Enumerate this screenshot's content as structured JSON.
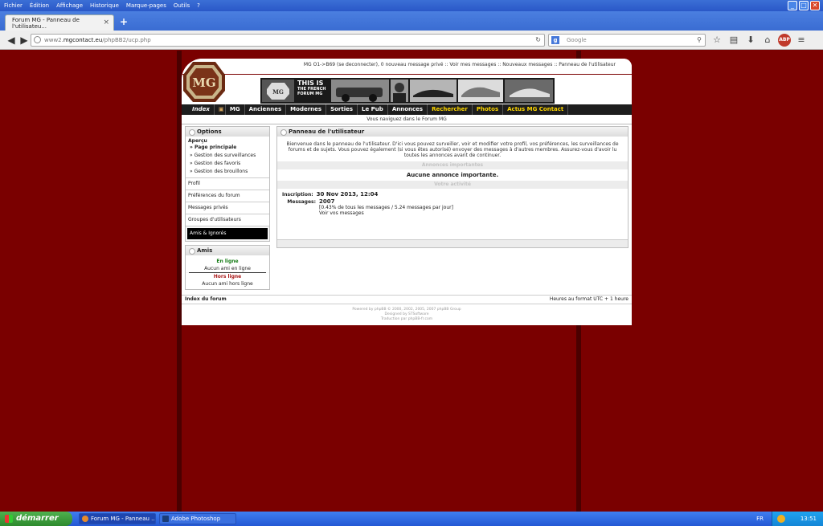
{
  "window": {
    "menu": [
      "Fichier",
      "Édition",
      "Affichage",
      "Historique",
      "Marque-pages",
      "Outils",
      "?"
    ],
    "buttons": {
      "minimize": "_",
      "maximize": "□",
      "close": "✕"
    }
  },
  "tab": {
    "title": "Forum MG - Panneau de l'utilisateu...",
    "close": "×",
    "new_tab": "+"
  },
  "navigation": {
    "url_prefix": "www2.",
    "url_host": "mgcontact.eu",
    "url_path": "/phpBB2/ucp.php",
    "search_engine": "g",
    "search_placeholder": "Google",
    "reload": "↻",
    "search_go": "⚲"
  },
  "forum": {
    "user_bar": "MG O1->B69 (se deconnecter), 0 nouveau message privé :: Voir mes messages :: Nouveaux messages :: Panneau de l'utilisateur",
    "banner_title": "THIS IS",
    "banner_sub": "THE FRENCH",
    "banner_sub2": "FORUM MG",
    "nav": [
      "Index",
      "MG",
      "Anciennes",
      "Modernes",
      "Sorties",
      "Le Pub",
      "Annonces",
      "Rechercher",
      "Photos",
      "Actus MG Contact"
    ],
    "browsing": "Vous naviguez dans le Forum MG",
    "sidebar": {
      "options_title": "Options",
      "overview_title": "Aperçu",
      "overview_items": [
        "» Page principale",
        "» Gestion des surveillances",
        "» Gestion des favoris",
        "» Gestion des brouillons"
      ],
      "items": [
        "Profil",
        "Préférences du forum",
        "Messages privés",
        "Groupes d'utilisateurs",
        "Amis & Ignorés"
      ],
      "friends_title": "Amis",
      "online_label": "En ligne",
      "online_none": "Aucun ami en ligne",
      "offline_label": "Hors ligne",
      "offline_none": "Aucun ami hors ligne"
    },
    "main": {
      "title": "Panneau de l'utilisateur",
      "intro": "Bienvenue dans le panneau de l'utilisateur. D'ici vous pouvez surveiller, voir et modifier votre profil, vos préférences, les surveillances de forums et de sujets. Vous pouvez également (si vous êtes autorisé) envoyer des messages à d'autres membres. Assurez-vous d'avoir lu toutes les annonces avant de continuer.",
      "important_title": "Annonces importantes",
      "no_announcement": "Aucune annonce importante.",
      "activity_title": "Votre activité",
      "joined_label": "Inscription:",
      "joined_value": "30 Nov 2013, 12:04",
      "messages_label": "Messages:",
      "messages_value": "2007",
      "messages_detail": "[0.43% de tous les messages / 5.24 messages par jour]",
      "messages_link": "Voir vos messages"
    },
    "footer_left": "Index du forum",
    "footer_right": "Heures au format UTC + 1 heure",
    "credits1": "Powered by phpBB © 2000, 2002, 2005, 2007 phpBB Group",
    "credits2": "Designed by STSoftware",
    "credits3": "Traduction par phpBB-fr.com"
  },
  "taskbar": {
    "start": "démarrer",
    "items": [
      "Forum MG - Panneau ...",
      "Adobe Photoshop"
    ],
    "lang": "FR",
    "time": "13:51"
  },
  "colors": {
    "background": "#7a0000",
    "nav_highlight": "#ffd800",
    "online": "#167c16",
    "offline": "#a91919"
  }
}
